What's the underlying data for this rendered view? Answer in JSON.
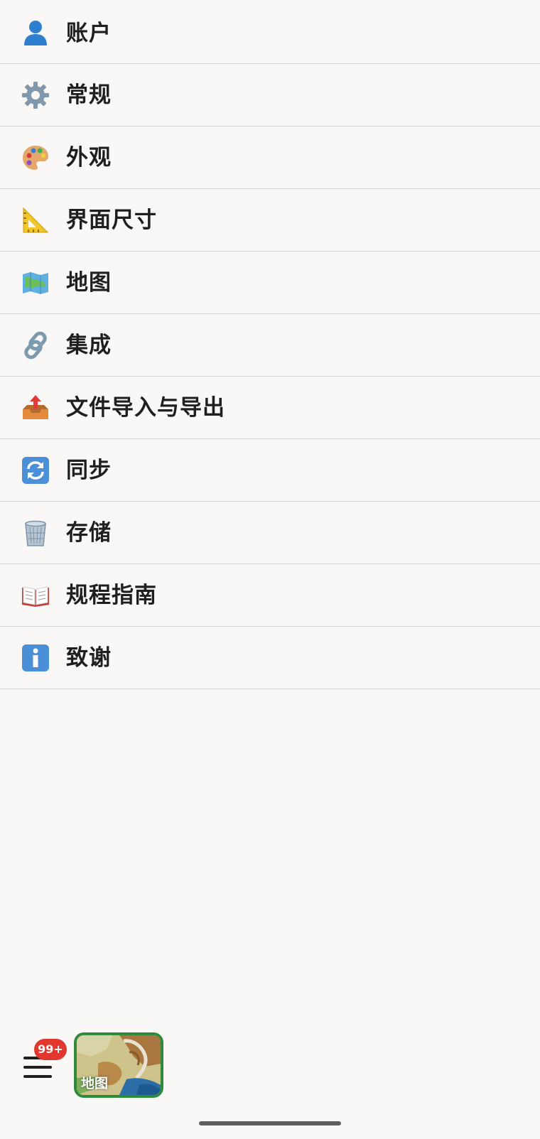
{
  "menu": {
    "items": [
      {
        "label": "账户",
        "icon": "person-icon"
      },
      {
        "label": "常规",
        "icon": "gear-icon"
      },
      {
        "label": "外观",
        "icon": "palette-icon"
      },
      {
        "label": "界面尺寸",
        "icon": "ruler-icon"
      },
      {
        "label": "地图",
        "icon": "map-icon"
      },
      {
        "label": "集成",
        "icon": "link-icon"
      },
      {
        "label": "文件导入与导出",
        "icon": "outbox-tray-icon"
      },
      {
        "label": "同步",
        "icon": "sync-arrows-icon"
      },
      {
        "label": "存储",
        "icon": "wastebasket-icon"
      },
      {
        "label": "规程指南",
        "icon": "open-book-icon"
      },
      {
        "label": "致谢",
        "icon": "information-icon"
      }
    ]
  },
  "bottom_bar": {
    "badge": "99+",
    "map_tile_label": "地图",
    "badge_color": "#e1372f",
    "tile_border_color": "#2f8a3a"
  }
}
